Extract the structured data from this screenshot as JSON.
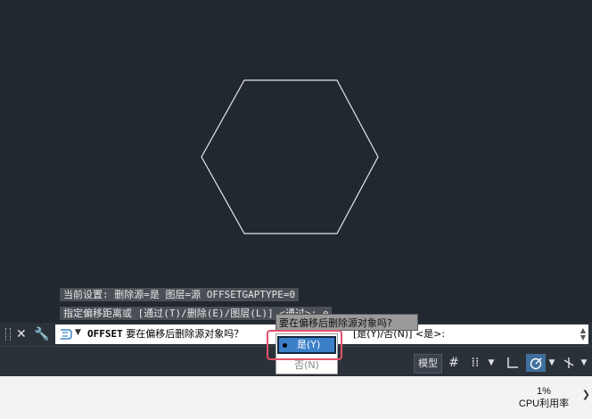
{
  "history": {
    "line1": "当前设置: 删除源=是  图层=源  OFFSETGAPTYPE=0",
    "line2": "指定偏移距离或 [通过(T)/删除(E)/图层(L)] <通过>: e"
  },
  "command": {
    "name": "OFFSET",
    "prompt": "要在偏移后删除源对象吗？",
    "options_bracket": "[是(Y)/否(N)]",
    "default": "<是>:"
  },
  "tooltip": {
    "text": "要在偏移后删除源对象吗?"
  },
  "dropdown": {
    "options": [
      {
        "label": "是(Y)",
        "selected": true
      },
      {
        "label": "否(N)",
        "selected": false
      }
    ]
  },
  "statusbar": {
    "model_label": "模型"
  },
  "taskbar": {
    "cpu_value": "1%",
    "cpu_label": "CPU利用率"
  },
  "colors": {
    "canvas_bg": "#212830",
    "accent": "#3b7fc9",
    "highlight": "#e0526b"
  },
  "icons": [
    "close-icon",
    "wrench-icon",
    "command-icon",
    "grid-icon",
    "snap-icon",
    "ortho-icon",
    "polar-icon",
    "isodraft-icon"
  ]
}
